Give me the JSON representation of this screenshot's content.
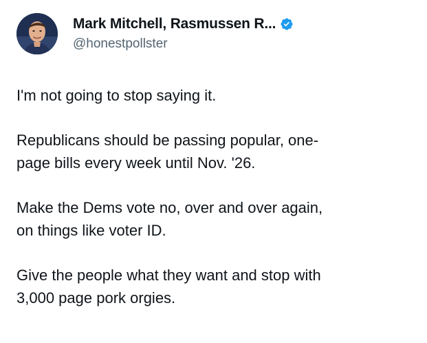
{
  "author": {
    "display_name": "Mark Mitchell, Rasmussen R...",
    "handle": "@honestpollster",
    "verified": true,
    "verified_color": "#1d9bf0",
    "avatar": "profile-photo"
  },
  "tweet": {
    "paragraphs": [
      "I'm not going to stop saying it.",
      "Republicans should be passing popular, one-\npage bills every week until Nov. '26.",
      "Make the Dems vote no, over and over again,\non things like voter ID.",
      "Give the people what they want and stop with\n3,000 page pork orgies."
    ]
  }
}
